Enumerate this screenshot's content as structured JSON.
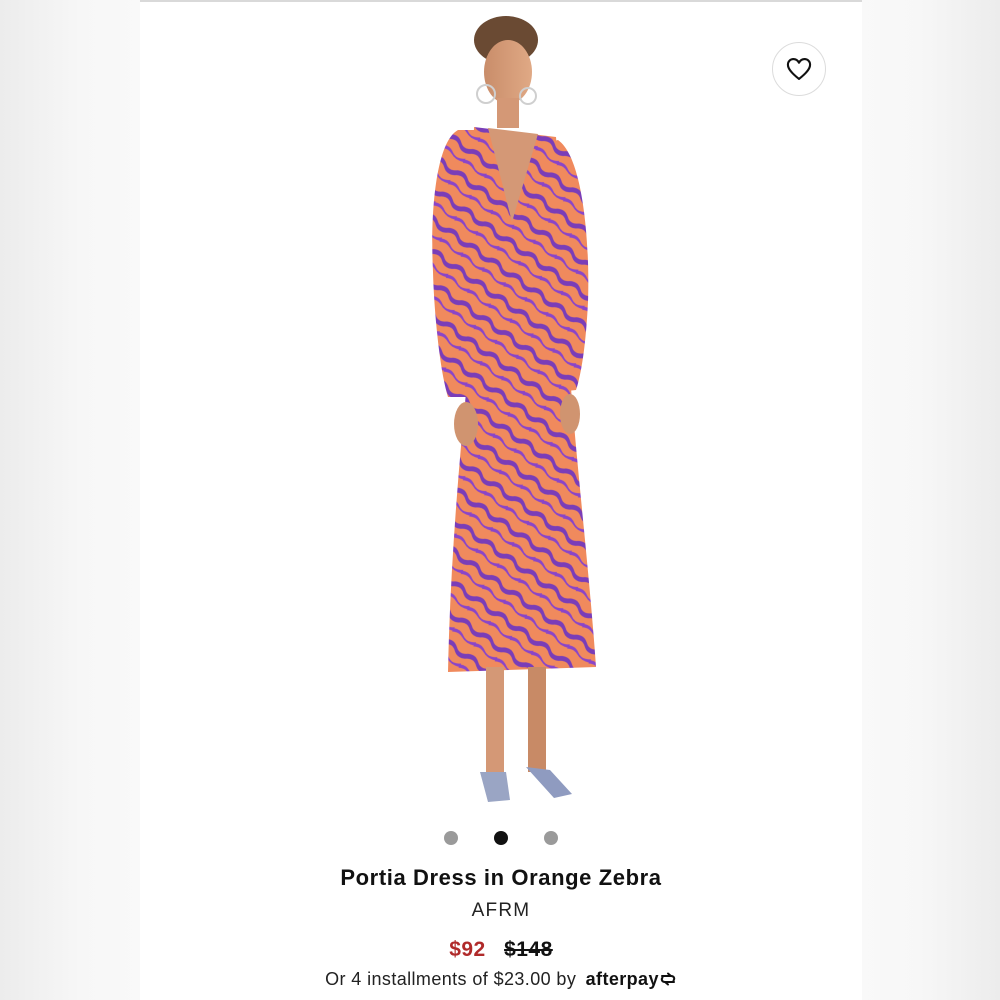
{
  "product": {
    "title": "Portia Dress in Orange Zebra",
    "brand": "AFRM",
    "price_sale": "$92",
    "price_original": "$148",
    "installments_text": "Or 4 installments of $23.00 by",
    "afterpay_label": "afterpay"
  },
  "gallery": {
    "image_count": 3,
    "active_index": 1
  },
  "icons": {
    "favorite": "heart-outline-icon",
    "afterpay": "afterpay-arrows-icon"
  },
  "colors": {
    "sale_price": "#b02a2a",
    "dot_active": "#111111",
    "dot_inactive": "#9a9a9a",
    "dress_orange": "#f08a5d",
    "dress_purple": "#7a3db8"
  }
}
